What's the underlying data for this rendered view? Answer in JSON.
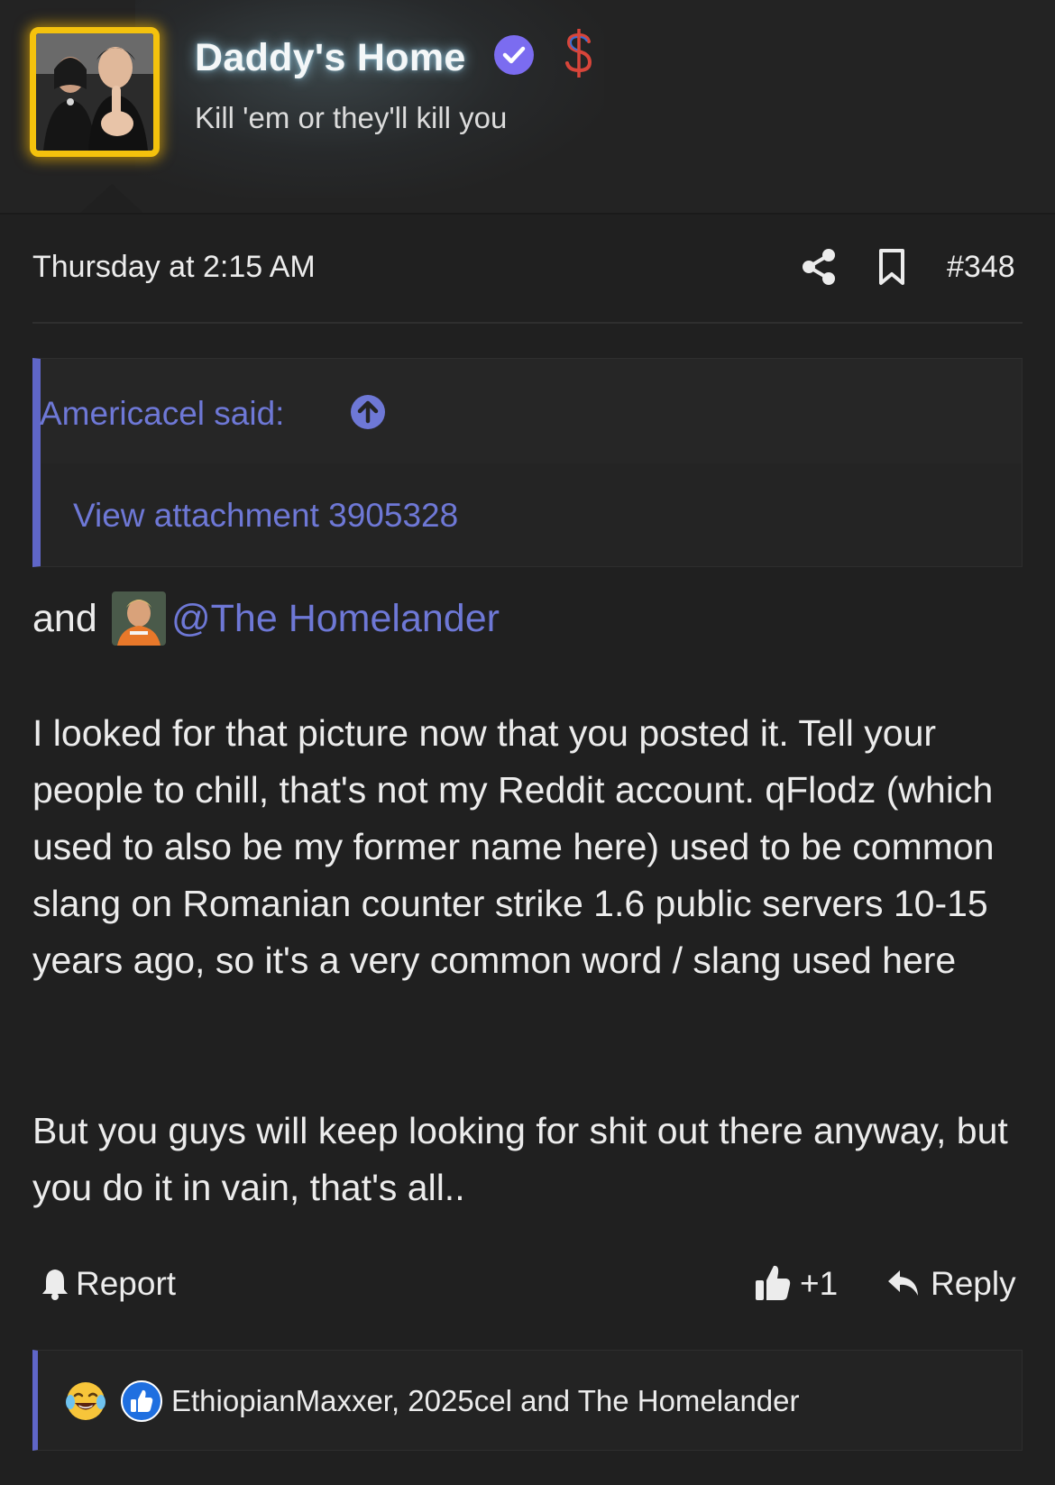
{
  "header": {
    "username": "Daddy's Home",
    "user_title": "Kill 'em or they'll kill you",
    "avatar_icon": "user-avatar",
    "verified_icon": "verified-badge-icon",
    "currency_icon": "dollar-icon",
    "colors": {
      "avatar_border": "#f4c20d",
      "verified": "#7b6cf0",
      "name_glow": "#aae6ff"
    }
  },
  "post": {
    "date": "Thursday at 2:15 AM",
    "number": "#348",
    "quote": {
      "author_label": "Americacel said:",
      "attachment_link": "View attachment 3905328"
    },
    "mention_prefix": "and",
    "mention": "@The Homelander",
    "paragraph_1": "I looked for that picture now that you posted it. Tell your people to chill, that's not my Reddit account. qFlodz (which used to also be my former name here) used to be common slang on Romanian counter strike 1.6 public servers 10-15 years ago, so it's a very common word / slang used here",
    "paragraph_2": "But you guys will keep looking for shit out there anyway, but you do it in vain, that's all..",
    "colors": {
      "link": "#6e78d6",
      "quote_bar": "#5f66c8",
      "background": "#202020",
      "text": "#ececec"
    }
  },
  "actions": {
    "report_label": "Report",
    "like_label": "+1",
    "reply_label": "Reply"
  },
  "reactions": {
    "emojis": [
      "laughing-crying-emoji",
      "thumbs-up-emoji"
    ],
    "users_text": "EthiopianMaxxer, 2025cel and The Homelander"
  }
}
